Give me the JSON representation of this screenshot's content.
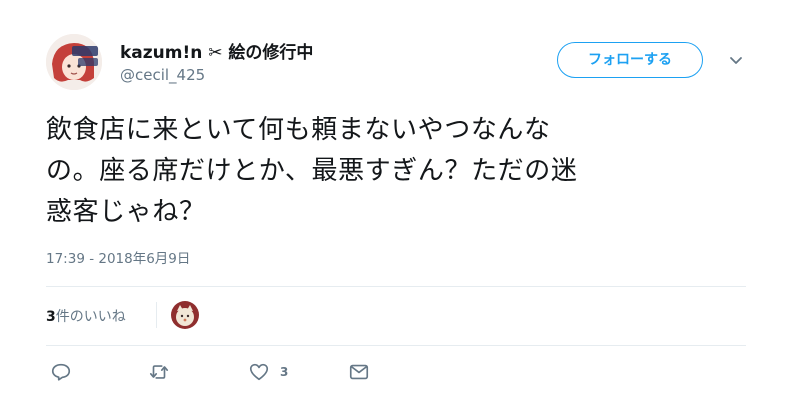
{
  "user": {
    "display_name": "kazum!n ✂ 絵の修行中",
    "handle": "@cecil_425",
    "avatar_icon": "profile-avatar"
  },
  "follow_button": {
    "label": "フォローする",
    "color": "#1da1f2"
  },
  "tweet": {
    "lines": [
      "飲食店に来といて何も頼まないやつなんな",
      "の。座る席だけとか、最悪すぎん？ただの迷",
      "惑客じゃね？"
    ]
  },
  "timestamp": "17:39 - 2018年6月9日",
  "likes": {
    "count": "3",
    "label": "件のいいね"
  },
  "actions": {
    "reply_icon": "reply-icon",
    "retweet_icon": "retweet-icon",
    "like_icon": "heart-icon",
    "like_count": "3",
    "dm_icon": "mail-icon"
  }
}
